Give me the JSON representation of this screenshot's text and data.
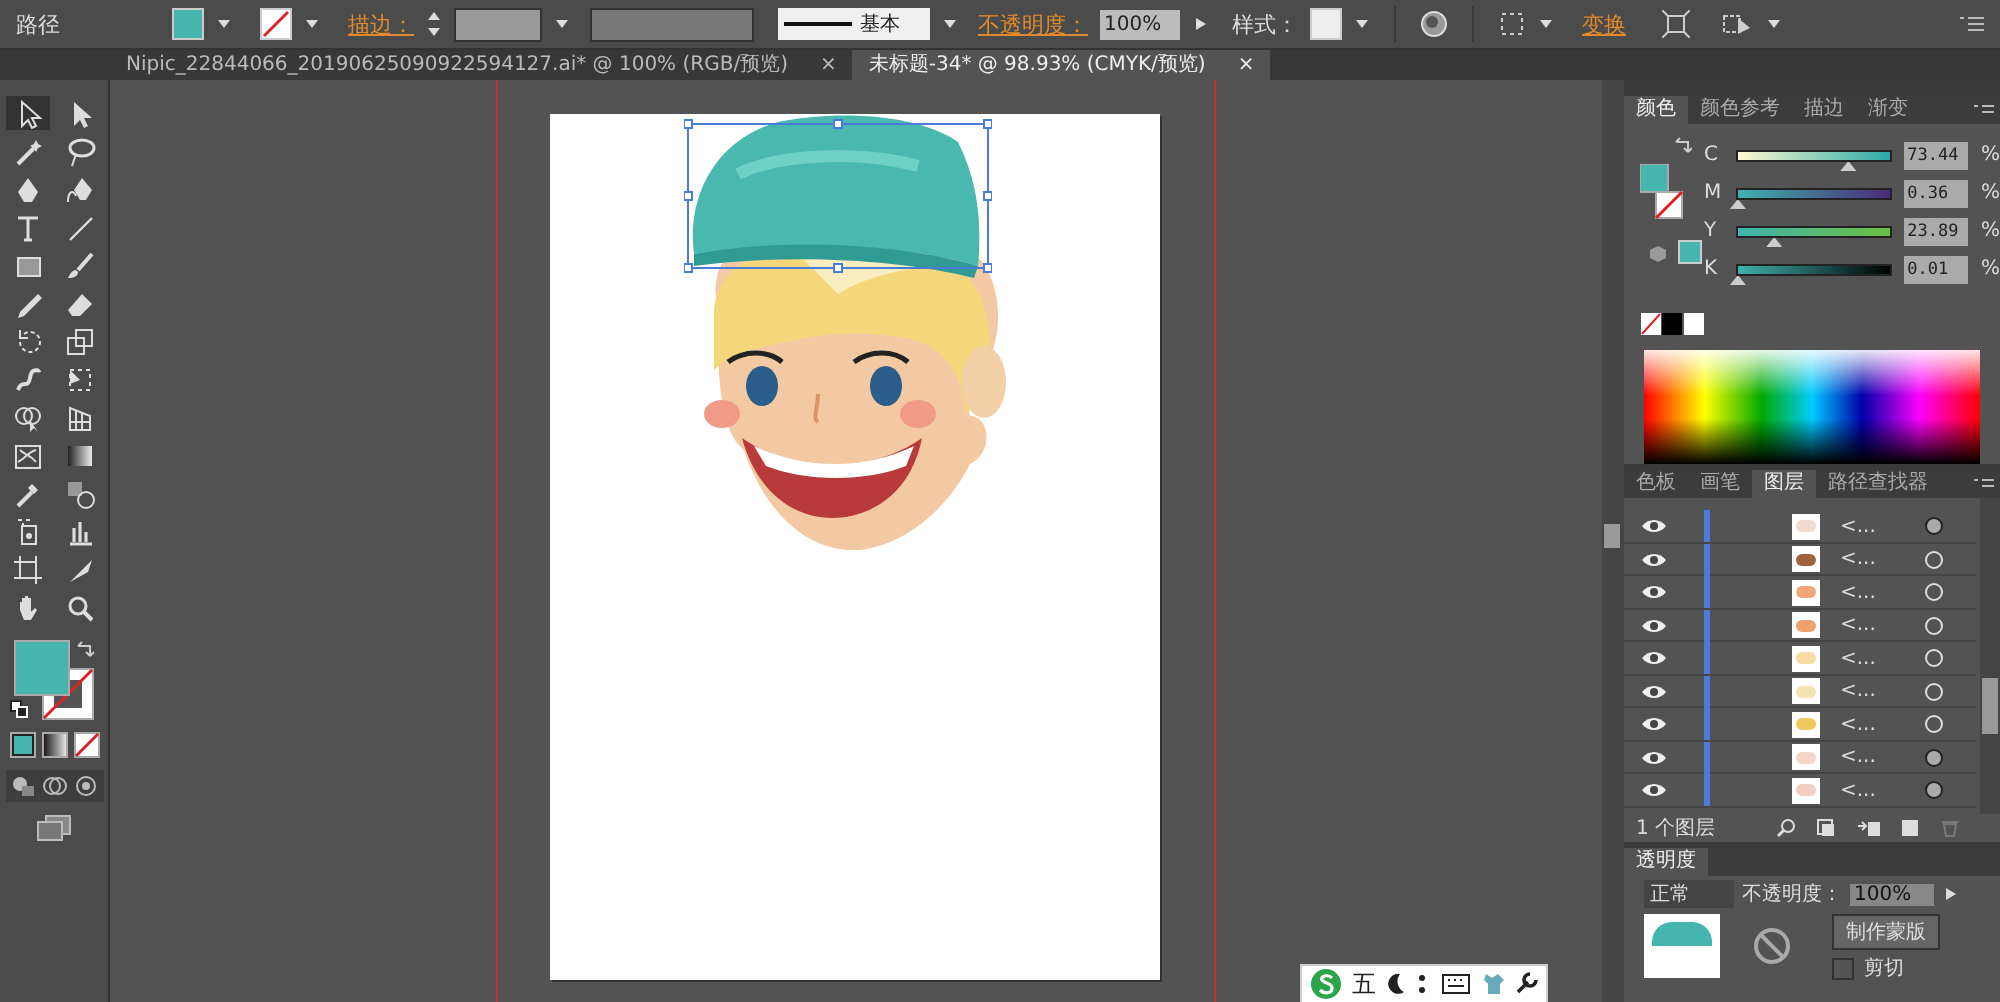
{
  "control_bar": {
    "object_type": "路径",
    "fill_swatch": {
      "color": "#45b5ad"
    },
    "stroke_label": "描边：",
    "stroke_style": "基本",
    "opacity_label": "不透明度：",
    "opacity_value": "100%",
    "style_label": "样式：",
    "transform_link": "变换"
  },
  "document_tabs": [
    {
      "title": "Nipic_22844066_20190625090922594127.ai* @ 100% (RGB/预览)",
      "close": "×",
      "selected": false
    },
    {
      "title": "未标题-34* @ 98.93% (CMYK/预览)",
      "close": "×",
      "selected": true
    }
  ],
  "toolbox": {
    "fill_swatch": {
      "color": "#45b5ad"
    }
  },
  "color_panel": {
    "tabs": [
      {
        "label": "颜色",
        "selected": true
      },
      {
        "label": "颜色参考",
        "selected": false
      },
      {
        "label": "描边",
        "selected": false
      },
      {
        "label": "渐变",
        "selected": false
      }
    ],
    "current_swatch": {
      "color": "#45b5ad"
    },
    "channels": [
      {
        "name": "C",
        "level": 0.73,
        "value": "73.44",
        "unit": "%"
      },
      {
        "name": "M",
        "level": 0.0,
        "value": "0.36",
        "unit": "%"
      },
      {
        "name": "Y",
        "level": 0.24,
        "value": "23.89",
        "unit": "%"
      },
      {
        "name": "K",
        "level": 0.0,
        "value": "0.01",
        "unit": "%"
      }
    ]
  },
  "layers_panel": {
    "tabs": [
      {
        "label": "色板",
        "selected": false
      },
      {
        "label": "画笔",
        "selected": false
      },
      {
        "label": "图层",
        "selected": true
      },
      {
        "label": "路径查找器",
        "selected": false
      }
    ],
    "rows": [
      {
        "name": "<...",
        "color": "#f3d9cf",
        "has_appearance": true
      },
      {
        "name": "<...",
        "color": "#a0623a",
        "has_appearance": false
      },
      {
        "name": "<...",
        "color": "#f2a77a",
        "has_appearance": false
      },
      {
        "name": "<...",
        "color": "#f0a070",
        "has_appearance": false
      },
      {
        "name": "<...",
        "color": "#f6dca0",
        "has_appearance": false
      },
      {
        "name": "<...",
        "color": "#f4e2b0",
        "has_appearance": false
      },
      {
        "name": "<...",
        "color": "#f0c860",
        "has_appearance": false
      },
      {
        "name": "<...",
        "color": "#f3d6c6",
        "has_appearance": true
      },
      {
        "name": "<...",
        "color": "#f1d0c0",
        "has_appearance": true
      }
    ],
    "count_label": "1 个图层"
  },
  "transparency_panel": {
    "title": "透明度",
    "blend_mode": "正常",
    "opacity_label": "不透明度：",
    "opacity_value": "100%",
    "mask_button": "制作蒙版",
    "clip_label": "剪切",
    "clip_checked": false
  },
  "ime_bar": {
    "mode_label": "五"
  }
}
